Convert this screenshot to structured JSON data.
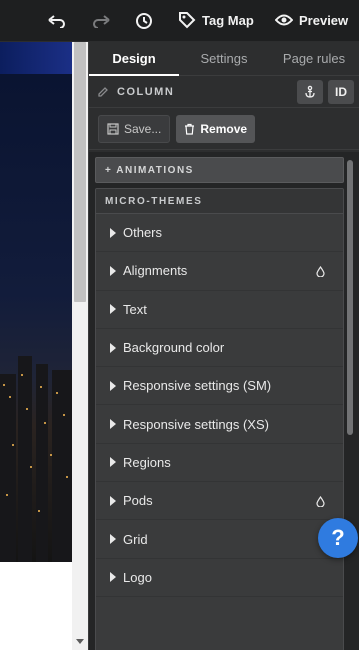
{
  "toolbar": {
    "undo_icon": "undo-icon",
    "redo_icon": "redo-icon",
    "history_icon": "history-icon",
    "tag_map_label": "Tag Map",
    "preview_label": "Preview"
  },
  "panel": {
    "tabs": [
      {
        "label": "Design",
        "active": true
      },
      {
        "label": "Settings",
        "active": false
      },
      {
        "label": "Page rules",
        "active": false
      }
    ],
    "component_title": "COLUMN",
    "anchor_icon": "anchor-icon",
    "id_label": "ID",
    "save_label": "Save...",
    "remove_label": "Remove",
    "animations_label": "+ ANIMATIONS",
    "micro_themes_label": "MICRO-THEMES",
    "items": [
      {
        "label": "Others",
        "drop": false
      },
      {
        "label": "Alignments",
        "drop": true
      },
      {
        "label": "Text",
        "drop": false
      },
      {
        "label": "Background color",
        "drop": false
      },
      {
        "label": "Responsive settings (SM)",
        "drop": false
      },
      {
        "label": "Responsive settings (XS)",
        "drop": false
      },
      {
        "label": "Regions",
        "drop": false
      },
      {
        "label": "Pods",
        "drop": true
      },
      {
        "label": "Grid",
        "drop": false
      },
      {
        "label": "Logo",
        "drop": false
      }
    ]
  },
  "help_label": "?",
  "colors": {
    "panel_bg": "#2d2e2f",
    "accent_help": "#2f7be0"
  }
}
